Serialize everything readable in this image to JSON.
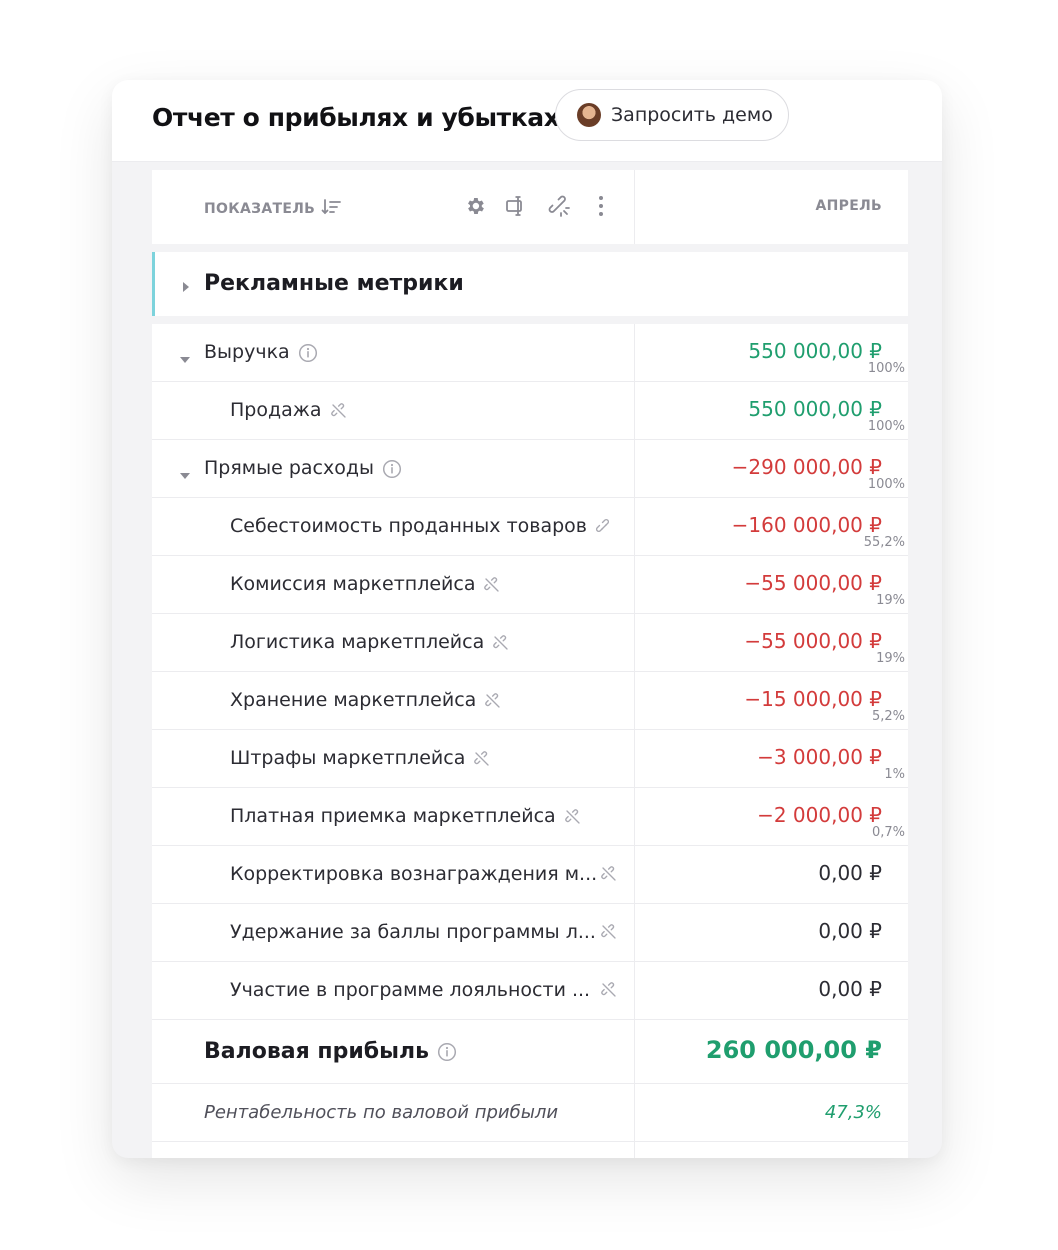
{
  "header": {
    "title": "Отчет о прибылях и убытках",
    "demo_button": "Запросить демо"
  },
  "table": {
    "indicator_header": "ПОКАЗАТЕЛЬ",
    "month_header": "АПРЕЛЬ",
    "section": "Рекламные метрики",
    "revenue": {
      "label": "Выручка",
      "value": "550 000,00 ₽",
      "pct": "100%"
    },
    "sale": {
      "label": "Продажа",
      "value": "550 000,00 ₽",
      "pct": "100%"
    },
    "direct_costs": {
      "label": "Прямые расходы",
      "value": "−290 000,00 ₽",
      "pct": "100%"
    },
    "cogs": {
      "label": "Себестоимость проданных товаров",
      "value": "−160 000,00 ₽",
      "pct": "55,2%"
    },
    "commission": {
      "label": "Комиссия маркетплейса",
      "value": "−55 000,00 ₽",
      "pct": "19%"
    },
    "logistics": {
      "label": "Логистика маркетплейса",
      "value": "−55 000,00 ₽",
      "pct": "19%"
    },
    "storage": {
      "label": "Хранение маркетплейса",
      "value": "−15 000,00 ₽",
      "pct": "5,2%"
    },
    "fines": {
      "label": "Штрафы маркетплейса",
      "value": "−3 000,00 ₽",
      "pct": "1%"
    },
    "paid_acceptance": {
      "label": "Платная приемка маркетплейса",
      "value": "−2 000,00 ₽",
      "pct": "0,7%"
    },
    "reward_adjustment": {
      "label": "Корректировка вознаграждения м...",
      "value": "0,00 ₽"
    },
    "loyalty_points": {
      "label": "Удержание за баллы программы л...",
      "value": "0,00 ₽"
    },
    "loyalty_program": {
      "label": "Участие в программе лояльности ...",
      "value": "0,00 ₽"
    },
    "gross_profit": {
      "label": "Валовая прибыль",
      "value": "260 000,00 ₽"
    },
    "gross_margin": {
      "label": "Рентабельность по валовой прибыли",
      "value": "47,3%"
    }
  },
  "colors": {
    "positive": "#1f9e6e",
    "negative": "#d33b3b",
    "section_accent": "#7dd3dc"
  },
  "icons": [
    "sort-icon",
    "gear-icon",
    "columns-icon",
    "unlink-icon",
    "more-vertical-icon",
    "info-icon",
    "caret-down-icon",
    "caret-right-icon",
    "link-icon"
  ]
}
